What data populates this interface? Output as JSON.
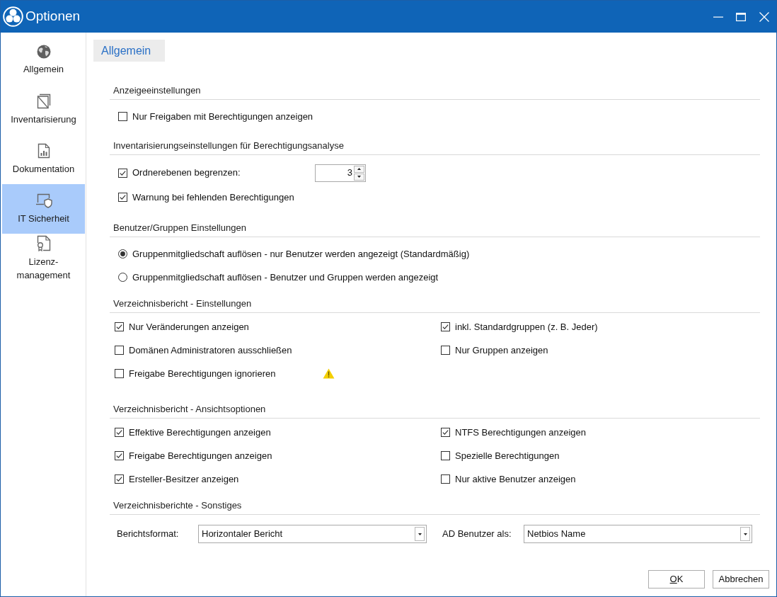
{
  "window": {
    "title": "Optionen"
  },
  "sidebar": {
    "items": [
      {
        "label": "Allgemein",
        "selected": false
      },
      {
        "label": "Inventarisierung",
        "selected": false
      },
      {
        "label": "Dokumentation",
        "selected": false
      },
      {
        "label": "IT Sicherheit",
        "selected": true
      },
      {
        "label": "Lizenz-\nmanagement",
        "selected": false
      }
    ]
  },
  "tabs": [
    {
      "label": "Allgemein",
      "selected": true
    }
  ],
  "sections": [
    {
      "kind": "options",
      "title": "Anzeigeeinstellungen",
      "items": [
        {
          "kind": "checkbox",
          "label": "Nur Freigaben mit Berechtigungen anzeigen",
          "checked": false
        }
      ]
    },
    {
      "kind": "options",
      "title": "Inventarisierungseinstellungen für Berechtigungsanalyse",
      "items": [
        {
          "kind": "checkbox",
          "label": "Ordnerebenen begrenzen:",
          "checked": true,
          "spinner": {
            "value": "3"
          }
        },
        {
          "kind": "checkbox",
          "label": "Warnung bei fehlenden Berechtigungen",
          "checked": true
        }
      ]
    },
    {
      "kind": "options",
      "title": "Benutzer/Gruppen Einstellungen",
      "items": [
        {
          "kind": "radio",
          "label": "Gruppenmitgliedschaft auflösen - nur Benutzer werden angezeigt (Standardmäßig)",
          "selected": true
        },
        {
          "kind": "radio",
          "label": "Gruppenmitgliedschaft auflösen - Benutzer und Gruppen werden angezeigt",
          "selected": false
        }
      ]
    },
    {
      "kind": "grid",
      "title": "Verzeichnisbericht - Einstellungen",
      "rows": [
        [
          {
            "kind": "checkbox",
            "label": "Nur Veränderungen anzeigen",
            "checked": true
          },
          {
            "kind": "checkbox",
            "label": "inkl. Standardgruppen (z. B. Jeder)",
            "checked": true
          }
        ],
        [
          {
            "kind": "checkbox",
            "label": "Domänen Administratoren ausschließen",
            "checked": false
          },
          {
            "kind": "checkbox",
            "label": "Nur Gruppen anzeigen",
            "checked": false
          }
        ],
        [
          {
            "kind": "checkbox",
            "label": "Freigabe Berechtigungen ignorieren",
            "checked": false,
            "warning": true
          }
        ]
      ]
    },
    {
      "kind": "grid",
      "title": "Verzeichnisbericht - Ansichtsoptionen",
      "rows": [
        [
          {
            "kind": "checkbox",
            "label": "Effektive Berechtigungen anzeigen",
            "checked": true
          },
          {
            "kind": "checkbox",
            "label": "NTFS Berechtigungen anzeigen",
            "checked": true
          }
        ],
        [
          {
            "kind": "checkbox",
            "label": "Freigabe Berechtigungen anzeigen",
            "checked": true
          },
          {
            "kind": "checkbox",
            "label": "Spezielle Berechtigungen",
            "checked": false
          }
        ],
        [
          {
            "kind": "checkbox",
            "label": "Ersteller-Besitzer anzeigen",
            "checked": true
          },
          {
            "kind": "checkbox",
            "label": "Nur aktive Benutzer anzeigen",
            "checked": false
          }
        ]
      ]
    },
    {
      "kind": "fields",
      "title": "Verzeichnisberichte - Sonstiges",
      "fields": [
        {
          "label": "Berichtsformat:",
          "value": "Horizontaler Bericht"
        },
        {
          "label": "AD Benutzer als:",
          "value": "Netbios Name"
        }
      ]
    }
  ],
  "buttons": [
    {
      "label": "OK",
      "underlined_initial": true
    },
    {
      "label": "Abbrechen",
      "underlined_initial": false
    }
  ]
}
